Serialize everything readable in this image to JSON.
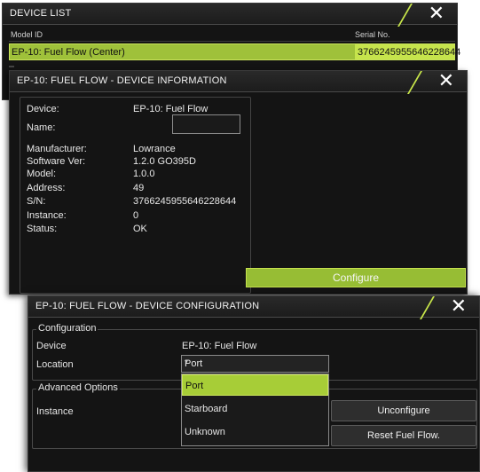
{
  "device_list": {
    "title": "DEVICE LIST",
    "columns": {
      "model": "Model ID",
      "serial": "Serial No."
    },
    "rows": [
      {
        "model": "EP-10: Fuel Flow (Center)",
        "serial": "3766245955646228644"
      }
    ]
  },
  "device_info": {
    "title": "EP-10: FUEL FLOW - DEVICE INFORMATION",
    "fields": {
      "device": {
        "label": "Device:",
        "value": "EP-10: Fuel Flow"
      },
      "name": {
        "label": "Name:",
        "value": ""
      },
      "manufacturer": {
        "label": "Manufacturer:",
        "value": "Lowrance"
      },
      "software": {
        "label": "Software Ver:",
        "value": "1.2.0 GO395D"
      },
      "model": {
        "label": "Model:",
        "value": "1.0.0"
      },
      "address": {
        "label": "Address:",
        "value": "49"
      },
      "sn": {
        "label": "S/N:",
        "value": "3766245955646228644"
      },
      "instance": {
        "label": "Instance:",
        "value": "0"
      },
      "status": {
        "label": "Status:",
        "value": "OK"
      }
    },
    "configure_label": "Configure"
  },
  "device_config": {
    "title": "EP-10: FUEL FLOW - DEVICE CONFIGURATION",
    "configuration_group": "Configuration",
    "device_label": "Device",
    "device_value": "EP-10: Fuel Flow",
    "location_label": "Location",
    "location_value": "Port",
    "location_options": [
      "Port",
      "Starboard",
      "Unknown"
    ],
    "advanced_group": "Advanced Options",
    "instance_label": "Instance",
    "unconfigure_label": "Unconfigure",
    "reset_label": "Reset Fuel Flow."
  },
  "icons": {
    "close": "close-icon",
    "dropdown_caret": "caret-down-icon"
  },
  "colors": {
    "accent_green": "#9fc13a",
    "accent_green_light": "#c6e44c",
    "panel_bg": "#141414"
  }
}
